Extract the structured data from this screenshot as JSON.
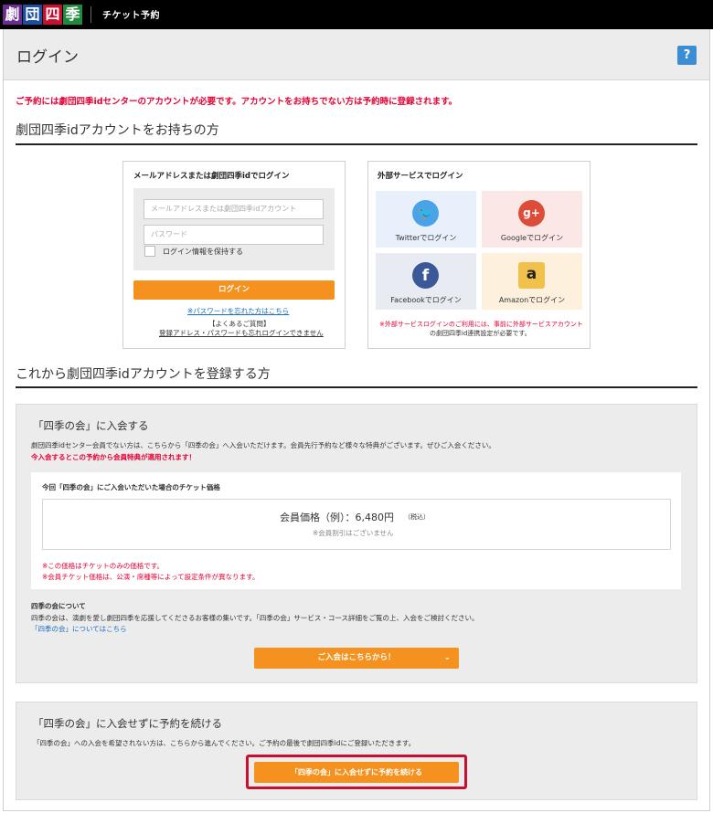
{
  "topbar": {
    "logo_chars": [
      "劇",
      "団",
      "四",
      "季"
    ],
    "app_name": "チケット予約"
  },
  "header": {
    "title": "ログイン",
    "help_label": "?"
  },
  "notice": "ご予約には劇団四季idセンターのアカウントが必要です。アカウントをお持ちでない方は予約時に登録されます。",
  "section_account": {
    "title": "劇団四季idアカウントをお持ちの方"
  },
  "login_panel": {
    "title": "メールアドレスまたは劇団四季idでログイン",
    "email_placeholder": "メールアドレスまたは劇団四季idアカウント",
    "password_placeholder": "パスワード",
    "remember_label": "ログイン情報を保持する",
    "login_button": "ログイン",
    "forgot_link": "※パスワードを忘れた方はこちら",
    "faq_label": "【よくあるご質問】",
    "faq_link": "登録アドレス・パスワードも忘れログインできません"
  },
  "external_panel": {
    "title": "外部サービスでログイン",
    "services": [
      {
        "label": "Twitterでログイン",
        "icon": "twitter-icon",
        "glyph": "🐦",
        "bg": "#e8f1fb",
        "icon_color": "#4aa3e8"
      },
      {
        "label": "Googleでログイン",
        "icon": "google-plus-icon",
        "glyph": "g+",
        "bg": "#fbe8e6",
        "icon_color": "#dd4b39"
      },
      {
        "label": "Facebookでログイン",
        "icon": "facebook-icon",
        "glyph": "f",
        "bg": "#e8ebf2",
        "icon_color": "#3b5998"
      },
      {
        "label": "Amazonでログイン",
        "icon": "amazon-icon",
        "glyph": "a",
        "bg": "#fdf0dc",
        "icon_color": "#f0c14b"
      }
    ],
    "note_line1": "※外部サービスログインのご利用には、事前に外部サービスアカウント",
    "note_line2": "の劇団四季id連携設定が必要です。"
  },
  "section_register": {
    "title": "これから劇団四季idアカウントを登録する方"
  },
  "join_box": {
    "title": "「四季の会」に入会する",
    "desc": "劇団四季idセンター会員でない方は、こちらから「四季の会」へ入会いただけます。会員先行予約など様々な特典がございます。ぜひご入会ください。",
    "highlight": "今入会するとこの予約から会員特典が適用されます！",
    "price_heading": "今回「四季の会」にご入会いただいた場合のチケット価格",
    "price_label": "会員価格（例）：6,480円",
    "price_tax": "（税込）",
    "price_sub": "※会員割引はございません",
    "price_note1": "※この価格はチケットのみの価格です。",
    "price_note2": "※会員チケット価格は、公演・席種等によって設定条件が異なります。",
    "about_title": "四季の会について",
    "about_desc": "四季の会は、演劇を愛し劇団四季を応援してくださるお客様の集いです。「四季の会」サービス・コース詳細をご覧の上、入会をご検討ください。",
    "about_link": "「四季の会」についてはこちら",
    "join_button": "ご入会はこちらから！"
  },
  "continue_box": {
    "title": "「四季の会」に入会せずに予約を続ける",
    "desc": "「四季の会」への入会を希望されない方は、こちらから進んでください。ご予約の最後で劇団四季idにご登録いただきます。",
    "continue_button": "「四季の会」に入会せずに予約を続ける"
  },
  "colors": {
    "accent_orange": "#f5911e",
    "alert_red": "#e60033",
    "link_blue": "#1a6fc4",
    "highlight_border": "#c8102e"
  }
}
